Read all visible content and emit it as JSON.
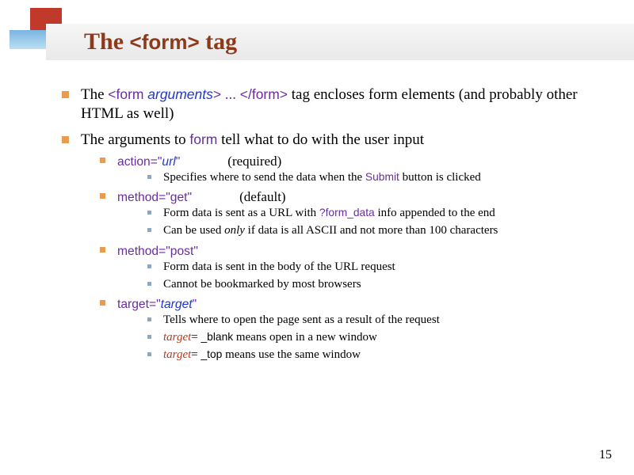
{
  "slide_number": "15",
  "title": {
    "pre": "The ",
    "code": "<form>",
    "post": " tag"
  },
  "p1": {
    "t1": "The ",
    "form_open_a": "<form ",
    "form_open_b": "arguments",
    "form_open_c": ">",
    "dots": " ... ",
    "form_close": "</form>",
    "t2": " tag encloses form elements (and probably other HTML as well)"
  },
  "p2": {
    "t1": "The arguments to ",
    "form_word": "form",
    "t2": " tell what to do with the user input"
  },
  "action": {
    "attr": "action=\"",
    "val": "url",
    "close": "\"",
    "note": "(required)",
    "sub1a": "Specifies where to send the data when the ",
    "sub1b": "Submit",
    "sub1c": " button is clicked"
  },
  "get": {
    "attr": "method=\"get\"",
    "note": "(default)",
    "sub1a": "Form data is sent as a URL with ",
    "sub1b": "?form_data",
    "sub1c": " info appended to the end",
    "sub2a": "Can be used ",
    "sub2b": "only",
    "sub2c": " if data is all ASCII and not more than 100 characters"
  },
  "post": {
    "attr": "method=\"post\"",
    "sub1": "Form data is sent in the body of the URL request",
    "sub2": "Cannot be bookmarked by most browsers"
  },
  "target": {
    "attr": "target=\"",
    "val": "target",
    "close": "\"",
    "sub1": "Tells where to open the page sent as a result of the request",
    "sub2a": "target",
    "sub2b": "= ",
    "sub2c": "_blank",
    "sub2d": " means open in a new window",
    "sub3a": "target",
    "sub3b": "= ",
    "sub3c": "_top",
    "sub3d": " means use the same window"
  }
}
